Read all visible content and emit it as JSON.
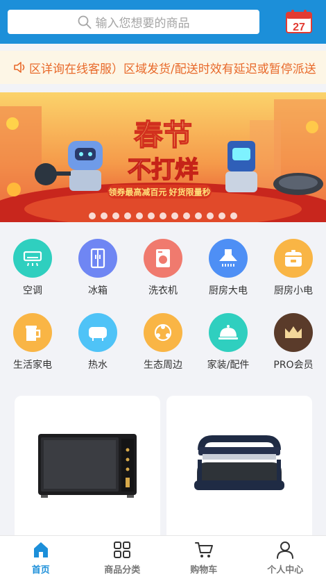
{
  "header": {
    "search_placeholder": "输入您想要的商品",
    "calendar_day": "27"
  },
  "notice": {
    "text": "区详询在线客服）区域发货/配送时效有延迟或暂停派送"
  },
  "banner": {
    "title_line1": "春节",
    "title_line2": "不打烊",
    "subtitle": "领券最高减百元 好货限量秒",
    "dot_count": 13
  },
  "categories": [
    {
      "label": "空调",
      "icon": "air-conditioner-icon",
      "color": "#2fcfbf"
    },
    {
      "label": "冰箱",
      "icon": "fridge-icon",
      "color": "#6f86f3"
    },
    {
      "label": "洗衣机",
      "icon": "washing-machine-icon",
      "color": "#f07a6e"
    },
    {
      "label": "厨房大电",
      "icon": "range-hood-icon",
      "color": "#4e8ff5"
    },
    {
      "label": "厨房小电",
      "icon": "rice-cooker-icon",
      "color": "#f9b545"
    },
    {
      "label": "生活家电",
      "icon": "kettle-icon",
      "color": "#f9b545"
    },
    {
      "label": "热水",
      "icon": "water-heater-icon",
      "color": "#4fc3f7"
    },
    {
      "label": "生态周边",
      "icon": "ecology-icon",
      "color": "#f9b545"
    },
    {
      "label": "家装/配件",
      "icon": "cloche-icon",
      "color": "#2fcfbf"
    },
    {
      "label": "PRO会员",
      "icon": "crown-icon",
      "color": "#5a3b2a"
    }
  ],
  "products": [
    {
      "name": "microwave-oven"
    },
    {
      "name": "grill-pan"
    }
  ],
  "tabbar": [
    {
      "label": "首页",
      "icon": "home-icon",
      "active": true
    },
    {
      "label": "商品分类",
      "icon": "category-icon",
      "active": false
    },
    {
      "label": "购物车",
      "icon": "cart-icon",
      "active": false
    },
    {
      "label": "个人中心",
      "icon": "user-icon",
      "active": false
    }
  ],
  "colors": {
    "primary": "#1c8fd9",
    "notice_text": "#e8692a",
    "notice_bg": "#fdf6e6"
  }
}
